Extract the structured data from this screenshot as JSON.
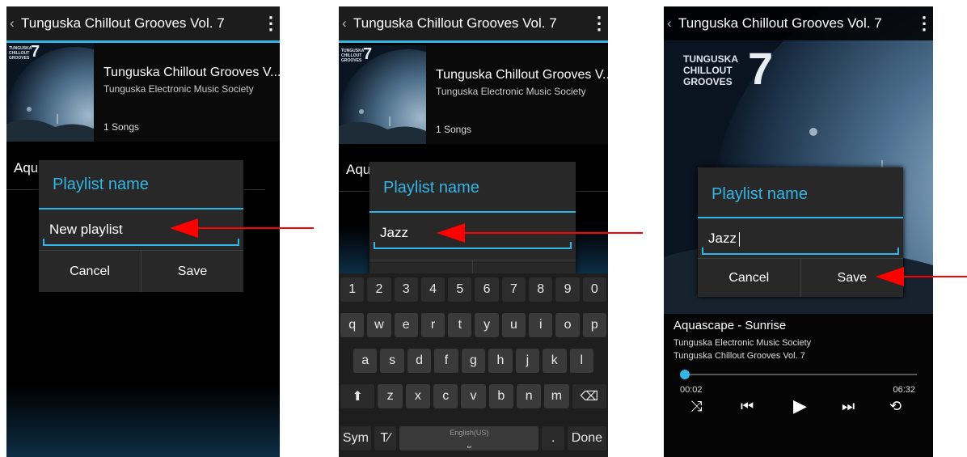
{
  "panel1": {
    "back_glyph": "‹",
    "title": "Tunguska Chillout Grooves Vol. 7",
    "overflow_glyph": "⋮",
    "cover_text": [
      "TUNGUSKA",
      "CHILLOUT",
      "GROOVES"
    ],
    "cover_number": "7",
    "album_title": "Tunguska Chillout Grooves V...",
    "album_artist": "Tunguska Electronic Music Society",
    "songs": "1 Songs",
    "track_fragment": "Aqu",
    "dialog": {
      "title": "Playlist name",
      "input_value": "New playlist",
      "cancel": "Cancel",
      "save": "Save"
    }
  },
  "panel2": {
    "back_glyph": "‹",
    "title": "Tunguska Chillout Grooves Vol. 7",
    "overflow_glyph": "⋮",
    "cover_text": [
      "TUNGUSKA",
      "CHILLOUT",
      "GROOVES"
    ],
    "cover_number": "7",
    "album_title": "Tunguska Chillout Grooves V...",
    "album_artist": "Tunguska Electronic Music Society",
    "songs": "1 Songs",
    "track_fragment": "Aqu",
    "dialog": {
      "title": "Playlist name",
      "input_value": "Jazz"
    },
    "keyboard": {
      "numbers": [
        "1",
        "2",
        "3",
        "4",
        "5",
        "6",
        "7",
        "8",
        "9",
        "0"
      ],
      "row1": [
        "q",
        "w",
        "e",
        "r",
        "t",
        "y",
        "u",
        "i",
        "o",
        "p"
      ],
      "row2": [
        "a",
        "s",
        "d",
        "f",
        "g",
        "h",
        "j",
        "k",
        "l"
      ],
      "row3": [
        "z",
        "x",
        "c",
        "v",
        "b",
        "n",
        "m"
      ],
      "shift_glyph": "⬆",
      "backspace_glyph": "⌫",
      "sym": "Sym",
      "space_label": "English(US)",
      "period": ".",
      "done": "Done"
    }
  },
  "panel3": {
    "back_glyph": "‹",
    "title": "Tunguska Chillout Grooves Vol. 7",
    "overflow_glyph": "⋮",
    "cover_text": [
      "TUNGUSKA",
      "CHILLOUT",
      "GROOVES"
    ],
    "cover_number": "7",
    "dialog": {
      "title": "Playlist name",
      "input_value": "Jazz",
      "cancel": "Cancel",
      "save": "Save"
    },
    "track_title": "Aquascape - Sunrise",
    "artist": "Tunguska Electronic Music Society",
    "album": "Tunguska Chillout Grooves Vol. 7",
    "elapsed": "00:02",
    "duration": "06:32",
    "progress_fraction": 0.005,
    "controls": {
      "shuffle": "⤨",
      "prev": "⏮",
      "play": "▶",
      "next": "⏭",
      "repeat": "⟲"
    }
  },
  "colors": {
    "accent": "#33b5e5",
    "arrow": "#ff0000",
    "background": "#000000",
    "dialog": "#282828"
  }
}
